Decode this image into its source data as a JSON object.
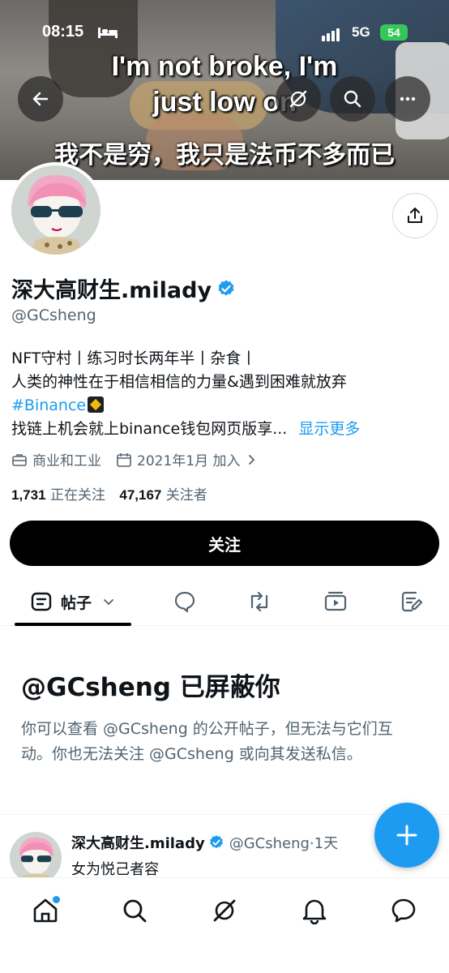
{
  "status_bar": {
    "time": "08:15",
    "network": "5G",
    "battery": "54"
  },
  "banner": {
    "subtitle_en_line1": "I'm not broke, I'm",
    "subtitle_en_line2": "just low on",
    "subtitle_zh": "我不是穷，我只是法币不多而已"
  },
  "profile": {
    "name": "深大高财生.milady",
    "handle": "@GCsheng",
    "bio_line1": "NFT守村丨练习时长两年半丨杂食丨",
    "bio_line2": "人类的神性在于相信相信的力量&遇到困难就放弃",
    "bio_hashtag": "#Binance",
    "bio_line4": "找链上机会就上binance钱包网页版享...",
    "show_more": "显示更多",
    "category": "商业和工业",
    "joined": "2021年1月 加入",
    "following_count": "1,731",
    "following_label": "正在关注",
    "followers_count": "47,167",
    "followers_label": "关注者",
    "follow_button": "关注"
  },
  "tabs": {
    "posts_label": "帖子"
  },
  "blocked": {
    "title": "@GCsheng 已屏蔽你",
    "desc_line1": "你可以查看 @GCsheng 的公开帖子，但无法与它们互",
    "desc_line2": "动。你也无法关注 @GCsheng 或向其发送私信。"
  },
  "post": {
    "name": "深大高财生.milady",
    "handle_time": "@GCsheng·1天",
    "text": "女为悦己者容"
  },
  "colors": {
    "accent": "#1d9bf0",
    "text": "#0f1419",
    "muted": "#536471"
  }
}
